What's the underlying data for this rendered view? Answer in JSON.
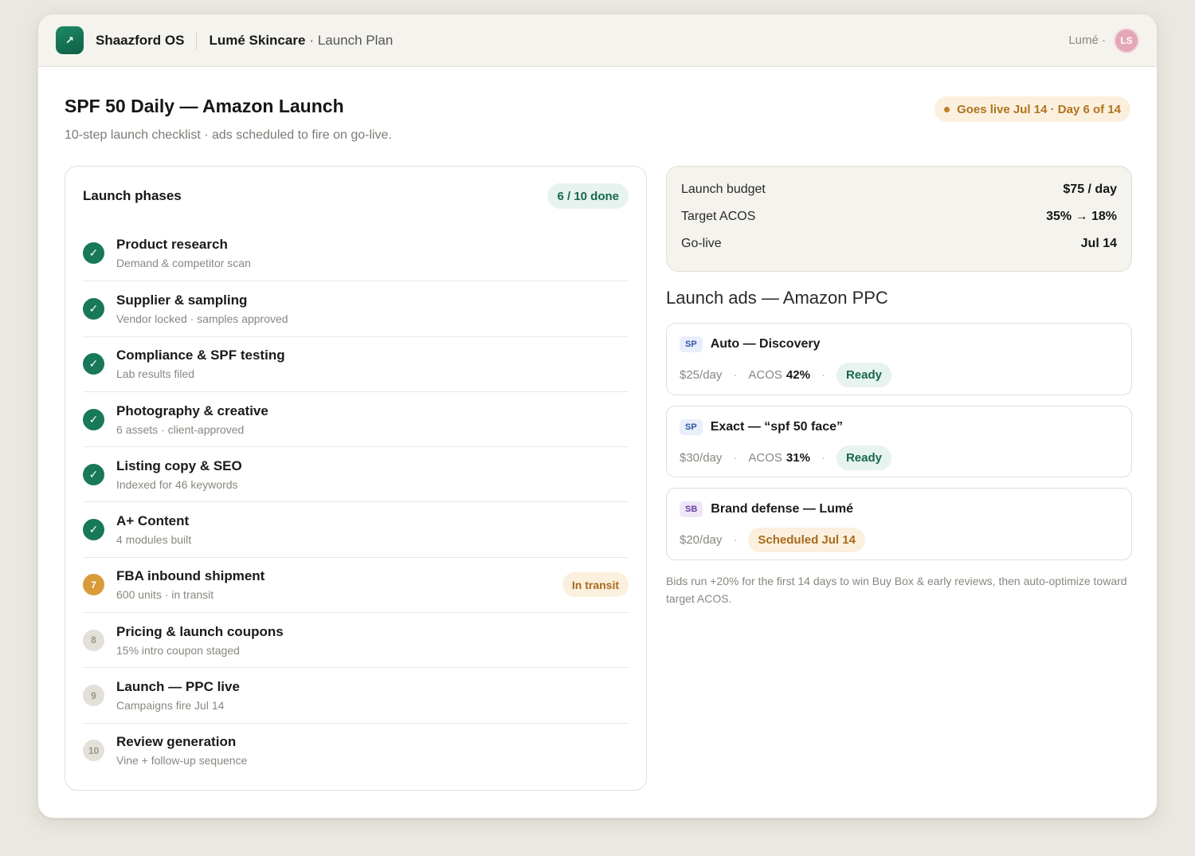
{
  "header": {
    "logo_glyph": "↗",
    "app_name": "Shaazford OS",
    "client": "Lumé Skincare",
    "crumb": "· Launch Plan",
    "user_label": "Lumé ·",
    "avatar_initials": "LS"
  },
  "page": {
    "title": "SPF 50 Daily — Amazon Launch",
    "subtitle": "10-step launch checklist · ads scheduled to fire on go-live.",
    "golive_badge": "Goes live Jul 14 · Day 6 of 14"
  },
  "phases": {
    "title": "Launch phases",
    "progress": "6 / 10 done",
    "items": [
      {
        "icon": "✓",
        "status": "done",
        "name": "Product research",
        "desc": "Demand & competitor scan"
      },
      {
        "icon": "✓",
        "status": "done",
        "name": "Supplier & sampling",
        "desc": "Vendor locked · samples approved"
      },
      {
        "icon": "✓",
        "status": "done",
        "name": "Compliance & SPF testing",
        "desc": "Lab results filed"
      },
      {
        "icon": "✓",
        "status": "done",
        "name": "Photography & creative",
        "desc": "6 assets · client-approved"
      },
      {
        "icon": "✓",
        "status": "done",
        "name": "Listing copy & SEO",
        "desc": "Indexed for 46 keywords"
      },
      {
        "icon": "✓",
        "status": "done",
        "name": "A+ Content",
        "desc": "4 modules built"
      },
      {
        "icon": "7",
        "status": "active",
        "name": "FBA inbound shipment",
        "desc": "600 units · in transit",
        "badge": "In transit"
      },
      {
        "icon": "8",
        "status": "todo",
        "name": "Pricing & launch coupons",
        "desc": "15% intro coupon staged"
      },
      {
        "icon": "9",
        "status": "todo",
        "name": "Launch — PPC live",
        "desc": "Campaigns fire Jul 14"
      },
      {
        "icon": "10",
        "status": "todo",
        "name": "Review generation",
        "desc": "Vine + follow-up sequence"
      }
    ]
  },
  "budget": {
    "rows": [
      {
        "label": "Launch budget",
        "value": "$75 / day"
      },
      {
        "label": "Target ACOS",
        "value": "35% → 18%"
      },
      {
        "label": "Go-live",
        "value": "Jul 14"
      }
    ]
  },
  "ads": {
    "title": "Launch ads — Amazon PPC",
    "items": [
      {
        "tag": "SP",
        "name": "Auto — Discovery",
        "budget": "$25/day",
        "acos_label": "ACOS",
        "acos": "42%",
        "status": "Ready"
      },
      {
        "tag": "SP",
        "name": "Exact — “spf 50 face”",
        "budget": "$30/day",
        "acos_label": "ACOS",
        "acos": "31%",
        "status": "Ready"
      },
      {
        "tag": "SB",
        "name": "Brand defense — Lumé",
        "budget": "$20/day",
        "status": "Scheduled Jul 14"
      }
    ],
    "separator": "·",
    "footnote": "Bids run +20% for the first 14 days to win Buy Box & early reviews, then auto-optimize toward target ACOS."
  },
  "colors": {
    "brand_green": "#17785a",
    "accent_amber": "#d99a3a",
    "background": "#ebe8e1"
  }
}
